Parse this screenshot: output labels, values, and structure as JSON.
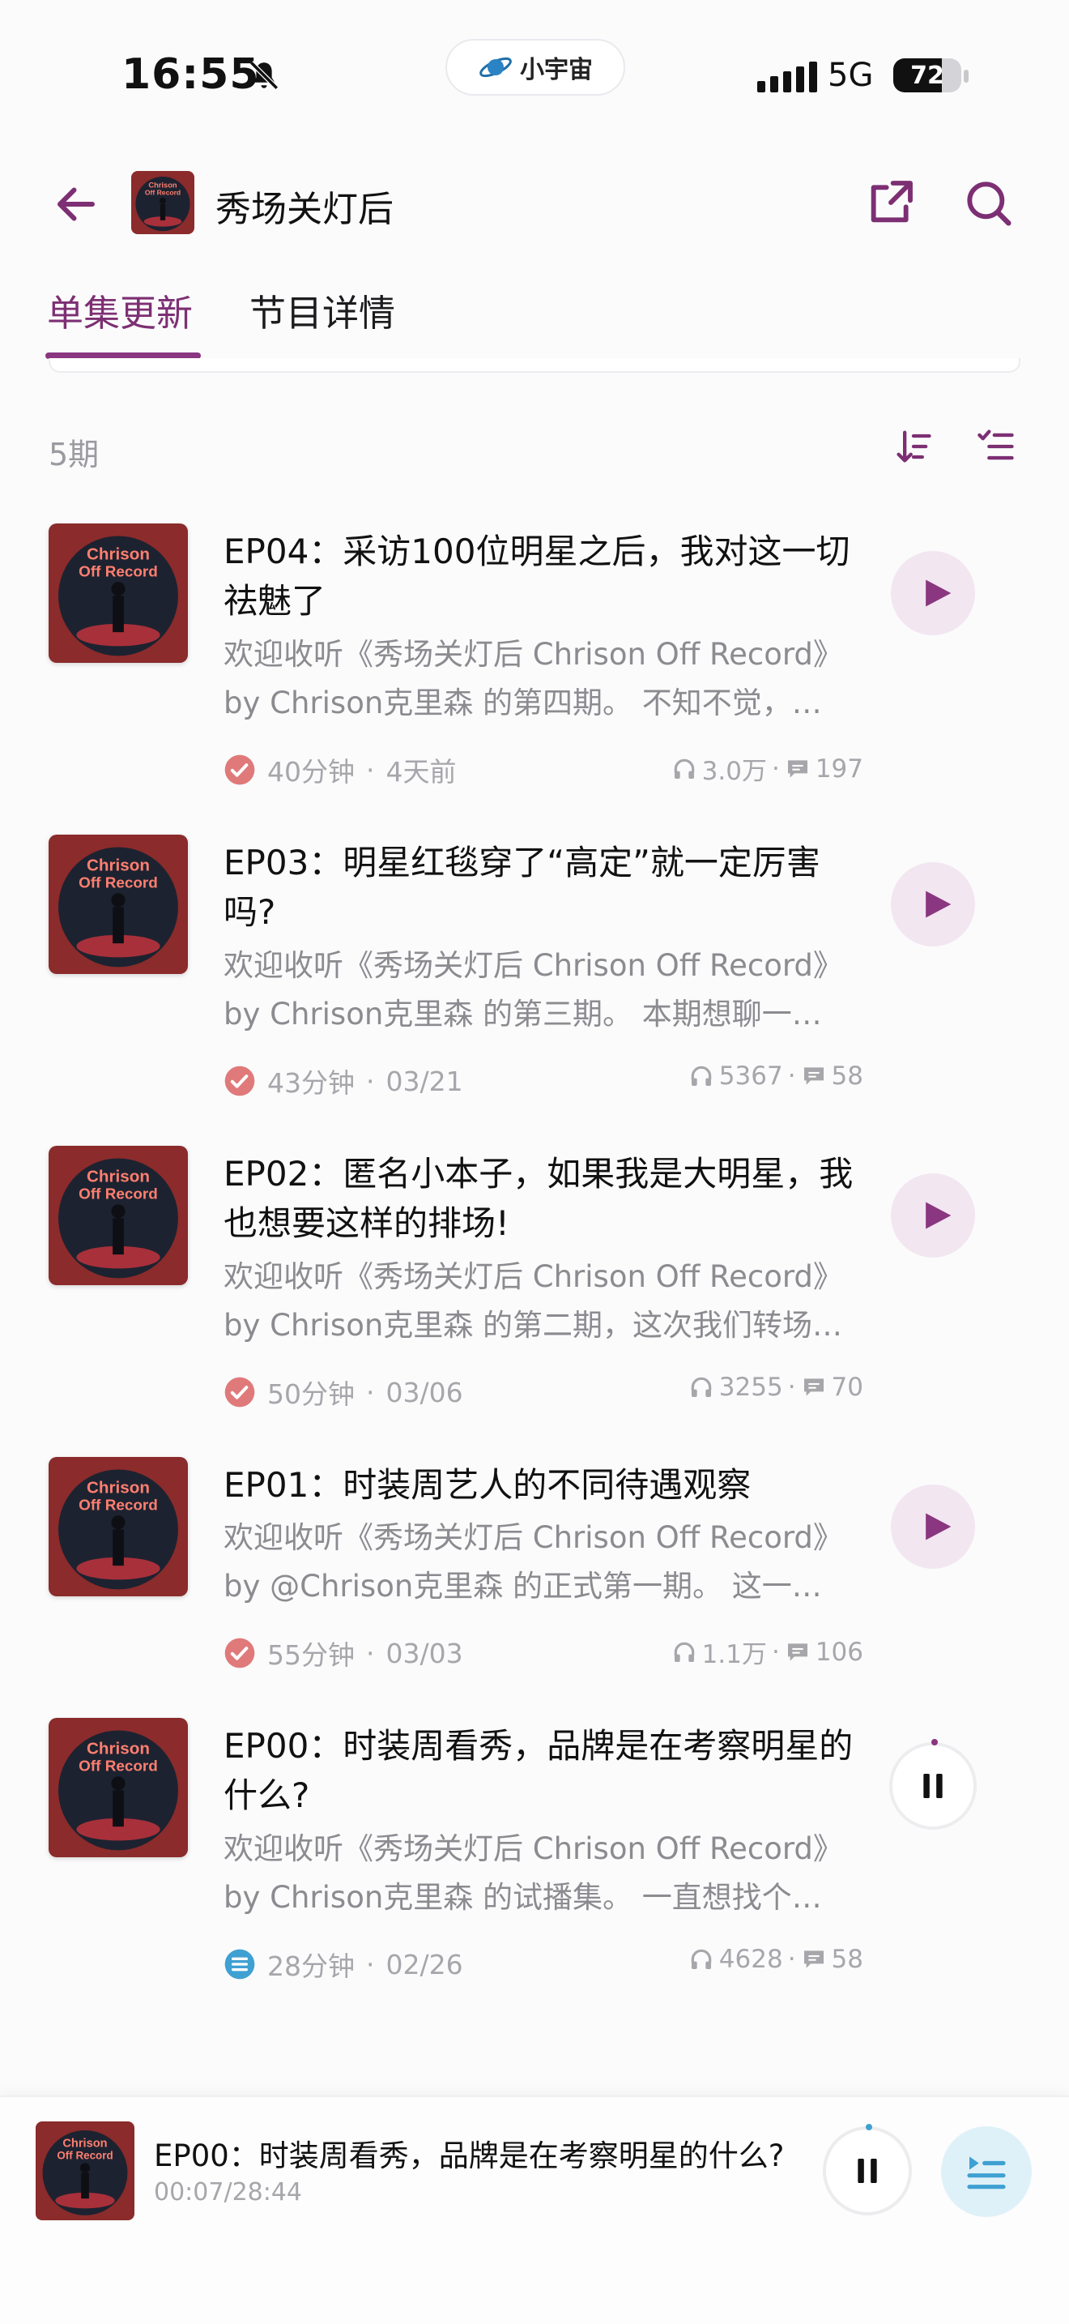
{
  "status_bar": {
    "time": "16:55",
    "island_label": "小宇宙",
    "network": "5G",
    "battery": "72",
    "battery_level": 0.72
  },
  "header": {
    "title": "秀场关灯后",
    "cover_text": [
      "Chrison",
      "Off Record"
    ]
  },
  "tabs": [
    {
      "label": "单集更新",
      "active": true
    },
    {
      "label": "节目详情",
      "active": false
    }
  ],
  "list": {
    "count": "5期"
  },
  "episodes": [
    {
      "title": "EP04：采访100位明星之后，我对这一切祛魅了",
      "desc_line1": "欢迎收听《秀场关灯后 Chrison Off Record》",
      "desc_line2": "by Chrison克里森 的第四期。 不知不觉，…",
      "duration": "40分钟",
      "date": "4天前",
      "plays": "3.0万",
      "comments": "197",
      "status": "played"
    },
    {
      "title": "EP03：明星红毯穿了“高定”就一定厉害吗?",
      "desc_line1": "欢迎收听《秀场关灯后 Chrison Off Record》",
      "desc_line2": "by Chrison克里森 的第三期。 本期想聊一…",
      "duration": "43分钟",
      "date": "03/21",
      "plays": "5367",
      "comments": "58",
      "status": "played"
    },
    {
      "title": "EP02：匿名小本子，如果我是大明星，我也想要这样的排场!",
      "desc_line1": "欢迎收听《秀场关灯后 Chrison Off Record》",
      "desc_line2": "by Chrison克里森 的第二期，这次我们转场…",
      "duration": "50分钟",
      "date": "03/06",
      "plays": "3255",
      "comments": "70",
      "status": "played"
    },
    {
      "title": "EP01：时装周艺人的不同待遇观察",
      "desc_line1": "欢迎收听《秀场关灯后 Chrison Off Record》",
      "desc_line2": "by @Chrison克里森 的正式第一期。 这一…",
      "duration": "55分钟",
      "date": "03/03",
      "plays": "1.1万",
      "comments": "106",
      "status": "played"
    },
    {
      "title": "EP00：时装周看秀，品牌是在考察明星的什么?",
      "desc_line1": "欢迎收听《秀场关灯后 Chrison Off Record》",
      "desc_line2": "by Chrison克里森 的试播集。 一直想找个…",
      "duration": "28分钟",
      "date": "02/26",
      "plays": "4628",
      "comments": "58",
      "status": "playing"
    }
  ],
  "mini_player": {
    "title": "EP00：时装周看秀，品牌是在考察明星的什么?",
    "time": "00:07/28:44"
  },
  "colors": {
    "accent": "#8a3680",
    "played_check": "#e07a7a",
    "playing_badge": "#3fa0d2",
    "cover_bg": "#8b2b2b"
  },
  "icons": {
    "back": "arrow-left-icon",
    "share": "share-icon",
    "search": "search-icon",
    "sort": "sort-icon",
    "filter": "filter-list-icon",
    "play": "play-icon",
    "pause": "pause-icon",
    "plays": "headphones-icon",
    "comments": "comment-icon",
    "played": "check-circle-icon",
    "playing": "list-badge-icon",
    "playlist": "playlist-icon"
  }
}
